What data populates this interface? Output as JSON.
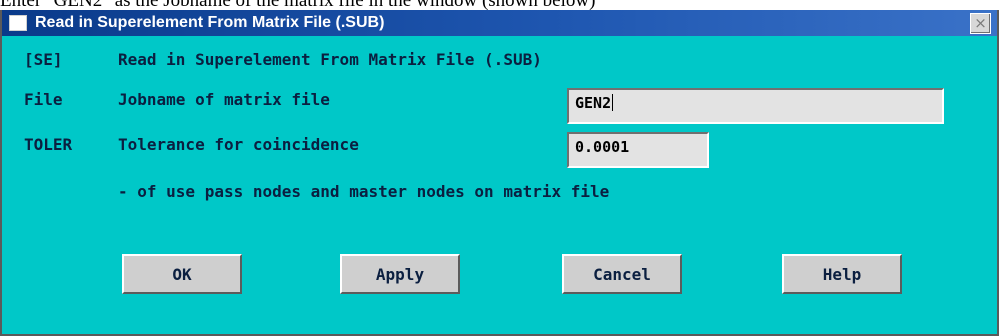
{
  "page_caption": "Enter \"GEN2\" as the Jobname of the matrix file in the window (shown below)",
  "window": {
    "title": "Read in Superelement From Matrix File (.SUB)",
    "close_glyph": "×"
  },
  "header": {
    "key": "[SE]",
    "text": "Read in Superelement From Matrix File (.SUB)"
  },
  "file_row": {
    "key": "File",
    "label": "Jobname of matrix file",
    "value": "GEN2"
  },
  "toler_row": {
    "key": "TOLER",
    "label": "Tolerance for coincidence",
    "value": "0.0001"
  },
  "note": "- of use pass nodes and master nodes on matrix file",
  "buttons": {
    "ok": "OK",
    "apply": "Apply",
    "cancel": "Cancel",
    "help": "Help"
  },
  "colors": {
    "dialog_bg": "#00c8c8",
    "titlebar": "#1e56b0",
    "field_bg": "#e3e3e3",
    "button_bg": "#cfcfcf",
    "label_text": "#0b1f40"
  }
}
